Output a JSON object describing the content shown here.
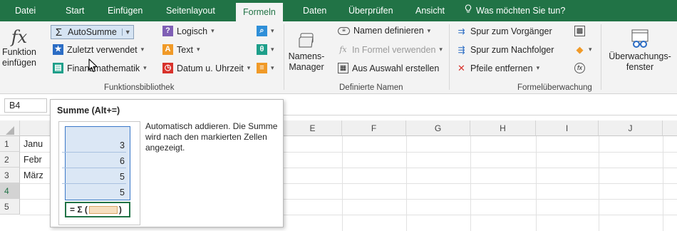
{
  "tabs": [
    {
      "label": "Datei",
      "active": false
    },
    {
      "label": "Start",
      "active": false
    },
    {
      "label": "Einfügen",
      "active": false
    },
    {
      "label": "Seitenlayout",
      "active": false
    },
    {
      "label": "Formeln",
      "active": true
    },
    {
      "label": "Daten",
      "active": false
    },
    {
      "label": "Überprüfen",
      "active": false
    },
    {
      "label": "Ansicht",
      "active": false
    }
  ],
  "tell_me": "Was möchten Sie tun?",
  "ribbon": {
    "funktion_einfuegen": [
      "Funktion",
      "einfügen"
    ],
    "autosumme": "AutoSumme",
    "zuletzt_verwendet": "Zuletzt verwendet",
    "finanzmathematik": "Finanzmathematik",
    "logisch": "Logisch",
    "text": "Text",
    "datum_uhrzeit": "Datum u. Uhrzeit",
    "group_funktionsbibliothek": "Funktionsbibliothek",
    "namens_manager": [
      "Namens-",
      "Manager"
    ],
    "namen_definieren": "Namen definieren",
    "in_formel_verwenden": "In Formel verwenden",
    "aus_auswahl_erstellen": "Aus Auswahl erstellen",
    "group_definierte_namen": "Definierte Namen",
    "spur_vorgaenger": "Spur zum Vorgänger",
    "spur_nachfolger": "Spur zum Nachfolger",
    "pfeile_entfernen": "Pfeile entfernen",
    "group_formelueberwachung": "Formelüberwachung",
    "ueberwachungsfenster": [
      "Überwachungs-",
      "fenster"
    ]
  },
  "name_box": "B4",
  "columns": [
    "E",
    "F",
    "G",
    "H",
    "I",
    "J"
  ],
  "rows": [
    {
      "num": "1",
      "a": "Janu"
    },
    {
      "num": "2",
      "a": "Febr"
    },
    {
      "num": "3",
      "a": "März"
    },
    {
      "num": "4",
      "a": ""
    },
    {
      "num": "5",
      "a": ""
    }
  ],
  "tooltip": {
    "title": "Summe (Alt+=)",
    "description": "Automatisch addieren. Die Summe wird nach den markierten Zellen angezeigt.",
    "values": [
      "3",
      "6",
      "5",
      "5"
    ],
    "formula": "= Σ (",
    "formula_close": ")"
  },
  "colors": {
    "excel_green": "#217346",
    "ribbon_bg": "#f3f3f3",
    "selection_blue": "#dbe7f5"
  }
}
